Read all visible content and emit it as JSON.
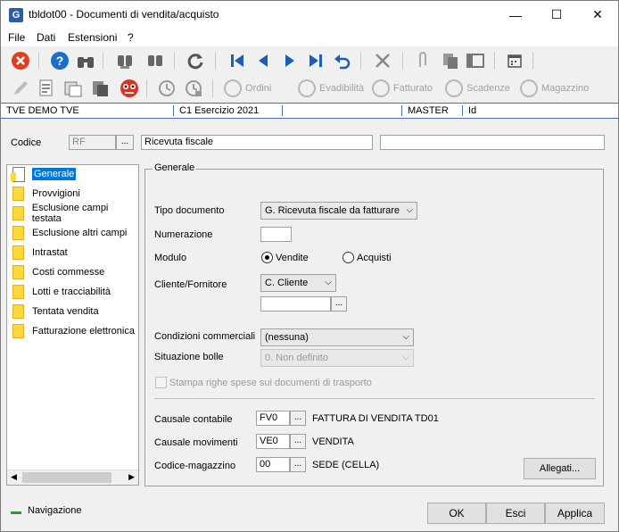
{
  "window": {
    "title": "tbldot00 - Documenti di vendita/acquisto",
    "app_icon": "G",
    "minimize": "—",
    "maximize": "☐",
    "close": "✕"
  },
  "menu": [
    "File",
    "Dati",
    "Estensioni",
    "?"
  ],
  "toolbar2": {
    "ordini": "Ordini",
    "evadibilita": "Evadibilità",
    "fatturato": "Fatturato",
    "scadenze": "Scadenze",
    "magazzino": "Magazzino"
  },
  "status_strip": {
    "company": "TVE DEMO TVE",
    "exercise": "C1 Esercizio 2021",
    "user": "MASTER",
    "id": "Id"
  },
  "code_row": {
    "label": "Codice",
    "code": "RF",
    "browse": "...",
    "description": "Ricevuta fiscale",
    "extra": ""
  },
  "tree": {
    "items": [
      "Generale",
      "Provvigioni",
      "Esclusione campi testata",
      "Esclusione altri campi",
      "Intrastat",
      "Costi commesse",
      "Lotti e tracciabilità",
      "Tentata vendita",
      "Fatturazione elettronica"
    ]
  },
  "general": {
    "group_title": "Generale",
    "tipo_documento_label": "Tipo documento",
    "tipo_documento_value": "G. Ricevuta fiscale da fatturare",
    "numerazione_label": "Numerazione",
    "numerazione_value": "",
    "modulo_label": "Modulo",
    "vendite": "Vendite",
    "acquisti": "Acquisti",
    "cliente_label": "Cliente/Fornitore",
    "cliente_value": "C. Cliente",
    "cliente_code": "",
    "browse": "...",
    "condizioni_label": "Condizioni commerciali",
    "condizioni_value": "(nessuna)",
    "situazione_label": "Situazione bolle",
    "situazione_value": "0. Non definito",
    "stampa_label": "Stampa righe spese sui documenti di trasporto",
    "causale_contabile_label": "Causale contabile",
    "causale_contabile_code": "FV0",
    "causale_contabile_desc": "FATTURA DI VENDITA TD01",
    "causale_movimenti_label": "Causale movimenti",
    "causale_movimenti_code": "VE0",
    "causale_movimenti_desc": "VENDITA",
    "magazzino_label": "Codice-magazzino",
    "magazzino_code": "00",
    "magazzino_desc": "SEDE (CELLA)",
    "allegati": "Allegati..."
  },
  "bottom": {
    "navigazione": "Navigazione",
    "ok": "OK",
    "esci": "Esci",
    "applica": "Applica"
  }
}
